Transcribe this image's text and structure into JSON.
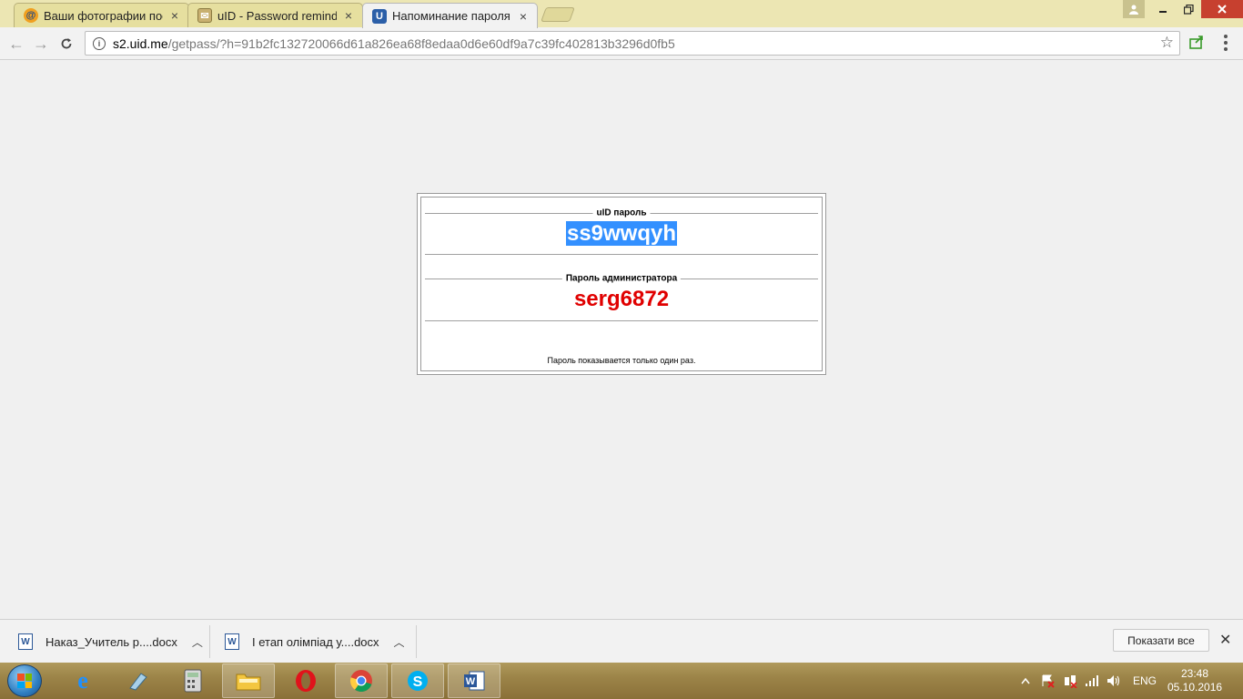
{
  "browser": {
    "tabs": [
      {
        "label": "Ваши фотографии посм",
        "favicon": "at-sign-icon",
        "active": false
      },
      {
        "label": "uID - Password remindin",
        "favicon": "mail-icon",
        "active": false
      },
      {
        "label": "Напоминание пароля",
        "favicon": "U",
        "active": true
      }
    ],
    "close_glyph": "×",
    "url_host": "s2.uid.me",
    "url_path": "/getpass/?h=91b2fc132720066d61a826ea68f8edaa0d6e60df9a7c39fc402813b3296d0fb5"
  },
  "page": {
    "uid_section_title": "uID пароль",
    "uid_password": "ss9wwqyh",
    "admin_section_title": "Пароль администратора",
    "admin_password": "serg6872",
    "note": "Пароль показывается только один раз.",
    "colors": {
      "selection": "#3390ff",
      "admin_password": "#e00000"
    }
  },
  "downloads": {
    "items": [
      {
        "name": "Наказ_Учитель р....docx",
        "icon": "word-doc-icon"
      },
      {
        "name": "І етап олімпіад у....docx",
        "icon": "word-doc-icon"
      }
    ],
    "show_all": "Показати все"
  },
  "taskbar": {
    "apps": [
      "internet-explorer-icon",
      "notepad-icon",
      "calculator-icon",
      "file-explorer-icon",
      "opera-icon",
      "chrome-icon",
      "skype-icon",
      "word-icon"
    ],
    "language": "ENG",
    "time": "23:48",
    "date": "05.10.2016"
  }
}
